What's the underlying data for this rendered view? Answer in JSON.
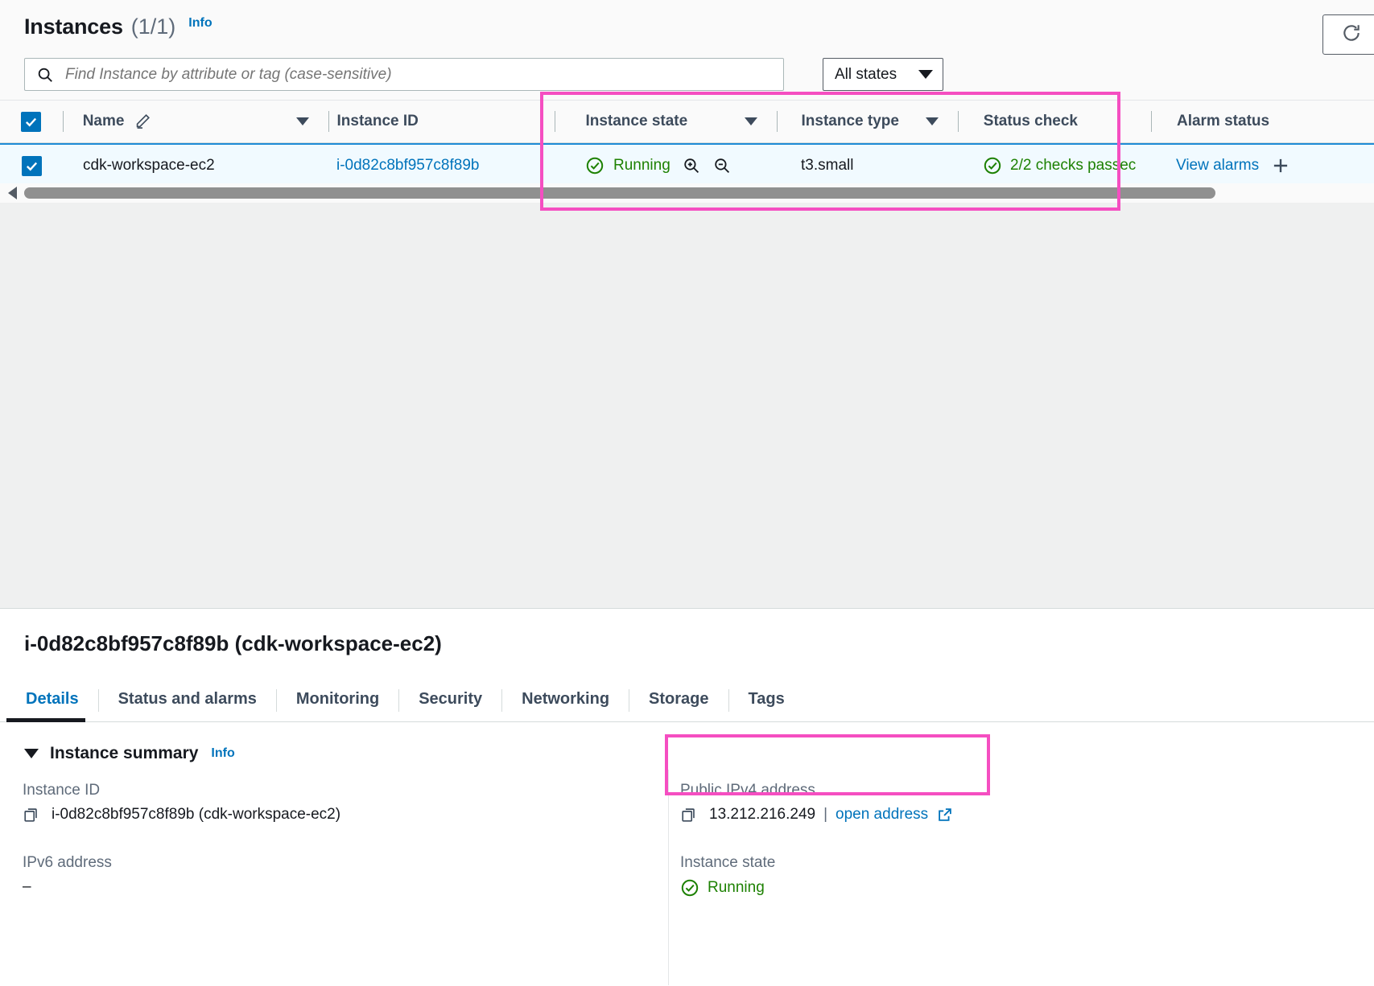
{
  "header": {
    "title": "Instances",
    "count": "(1/1)",
    "info_label": "Info",
    "refresh_icon": "refresh-icon"
  },
  "search": {
    "placeholder": "Find Instance by attribute or tag (case-sensitive)",
    "value": "",
    "icon": "search-icon"
  },
  "state_filter": {
    "selected": "All states",
    "icon": "chevron-down-icon"
  },
  "table": {
    "columns": [
      {
        "key": "name",
        "label": "Name",
        "sortable": true,
        "edit_icon": "pencil-icon"
      },
      {
        "key": "instance_id",
        "label": "Instance ID",
        "sortable": false
      },
      {
        "key": "instance_state",
        "label": "Instance state",
        "sortable": true
      },
      {
        "key": "instance_type",
        "label": "Instance type",
        "sortable": true
      },
      {
        "key": "status_check",
        "label": "Status check",
        "sortable": false
      },
      {
        "key": "alarm_status",
        "label": "Alarm status",
        "sortable": false
      }
    ],
    "rows": [
      {
        "selected": true,
        "name": "cdk-workspace-ec2",
        "instance_id": "i-0d82c8bf957c8f89b",
        "instance_state": "Running",
        "instance_state_icon": "check-circle-icon",
        "zoom_in_icon": "magnifier-plus-icon",
        "zoom_out_icon": "magnifier-minus-icon",
        "instance_type": "t3.small",
        "status_check": "2/2 checks passec",
        "status_check_icon": "check-circle-icon",
        "alarm_status": "View alarms",
        "alarm_add_icon": "plus-icon"
      }
    ],
    "scrollbar": {
      "left_arrow_icon": "caret-left-icon"
    }
  },
  "detail": {
    "title": "i-0d82c8bf957c8f89b (cdk-workspace-ec2)",
    "tabs": [
      {
        "label": "Details",
        "active": true
      },
      {
        "label": "Status and alarms",
        "active": false
      },
      {
        "label": "Monitoring",
        "active": false
      },
      {
        "label": "Security",
        "active": false
      },
      {
        "label": "Networking",
        "active": false
      },
      {
        "label": "Storage",
        "active": false
      },
      {
        "label": "Tags",
        "active": false
      }
    ],
    "summary": {
      "section_title": "Instance summary",
      "section_info": "Info",
      "fields": {
        "instance_id_label": "Instance ID",
        "instance_id_value": "i-0d82c8bf957c8f89b (cdk-workspace-ec2)",
        "public_ipv4_label": "Public IPv4 address",
        "public_ipv4_value": "13.212.216.249",
        "public_ipv4_link": "open address",
        "ipv6_label": "IPv6 address",
        "ipv6_value": "–",
        "instance_state_label": "Instance state",
        "instance_state_value": "Running"
      }
    },
    "splitter_icon": "resize-handle-icon"
  },
  "annotations": {
    "color": "#f54ec1",
    "boxes": [
      {
        "name": "columns-highlight"
      },
      {
        "name": "public-ipv4-highlight"
      }
    ]
  }
}
